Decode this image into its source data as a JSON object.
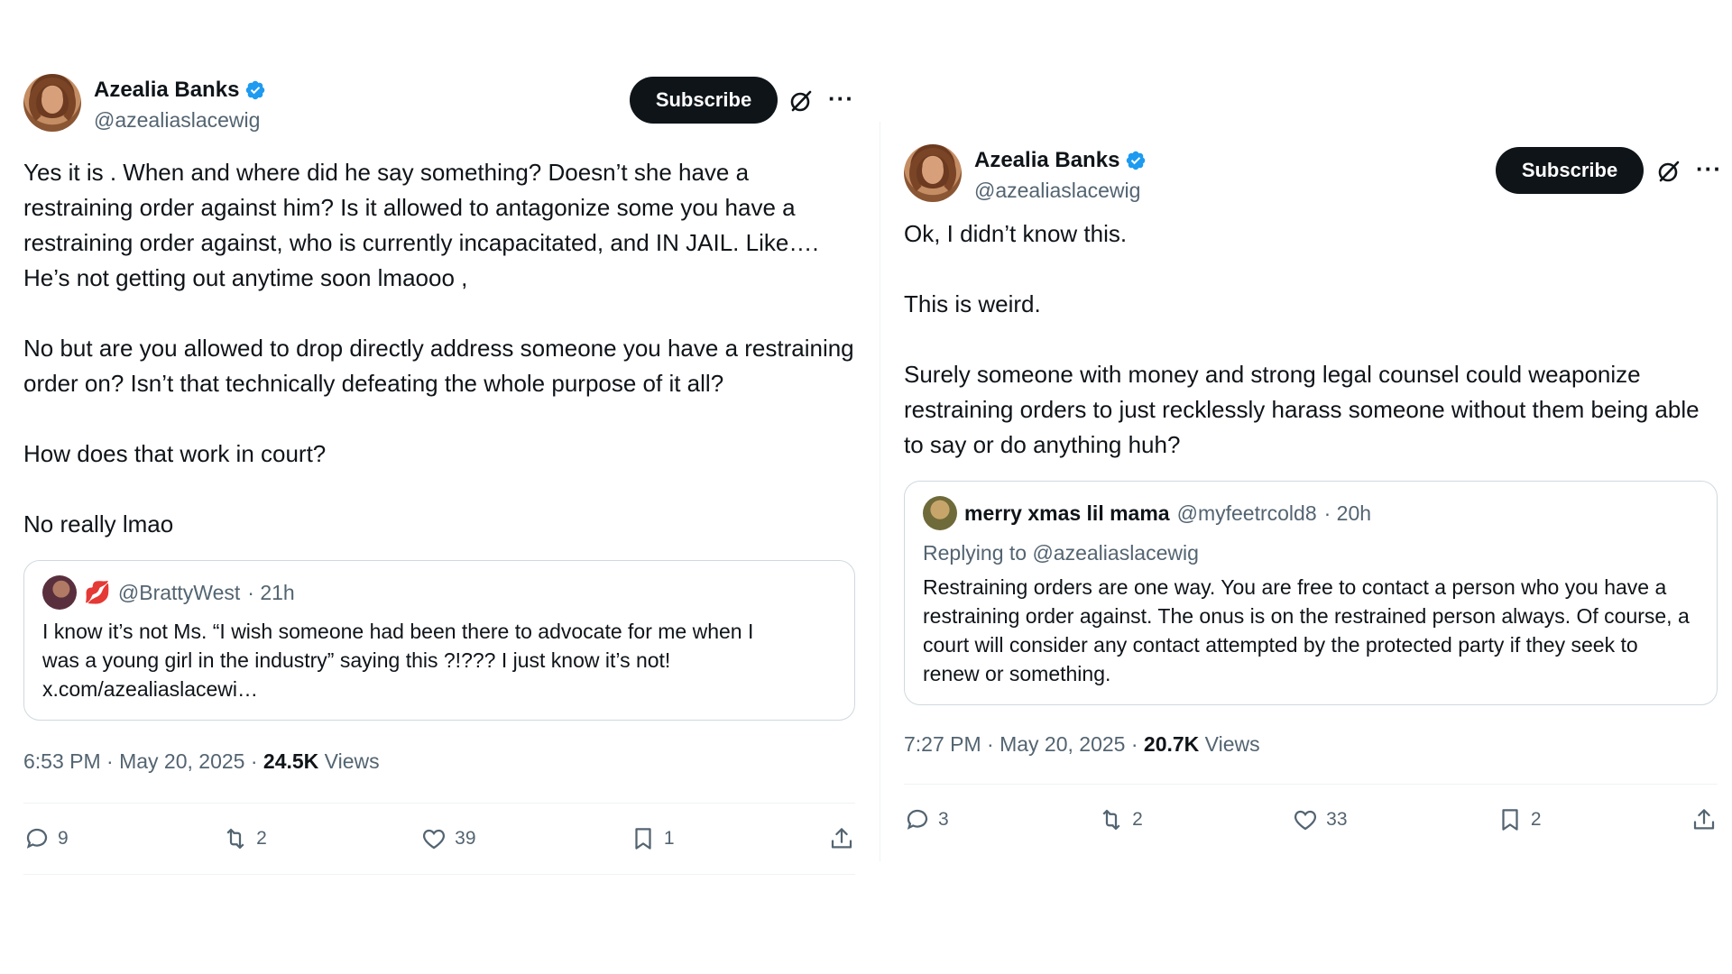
{
  "tweets": [
    {
      "display_name": "Azealia Banks",
      "handle": "@azealiaslacewig",
      "subscribe_label": "Subscribe",
      "more_label": "···",
      "paragraphs": [
        "Yes it is . When and where did he say something? Doesn’t she have a restraining order against him? Is it allowed to antagonize some you have a restraining order against, who is currently incapacitated, and IN JAIL. Like…. He’s not getting out anytime soon lmaooo ,",
        "No but are you allowed to drop directly address someone you have a restraining order on? Isn’t that technically defeating the whole purpose of it all?",
        "How does that work in court?",
        "No really lmao"
      ],
      "quote": {
        "emoji": "💋",
        "handle": "@BrattyWest",
        "time": "· 21h",
        "text_line1": "I know it’s not Ms. “I wish someone had been there to advocate for me when I",
        "text_line2": "was a young girl in the industry” saying this ?!??? I just know it’s not!",
        "text_line3": "x.com/azealiaslacewi…"
      },
      "time": "6:53 PM · May 20, 2025 ·",
      "views_count": "24.5K",
      "views_label": "Views",
      "actions": {
        "replies": "9",
        "reposts": "2",
        "likes": "39",
        "bookmarks": "1"
      }
    },
    {
      "display_name": "Azealia Banks",
      "handle": "@azealiaslacewig",
      "subscribe_label": "Subscribe",
      "more_label": "···",
      "paragraphs": [
        "Ok, I didn’t know this.",
        "This is weird.",
        "Surely someone with money and strong legal counsel could weaponize restraining orders to just recklessly harass someone without them being able to say or do anything huh?"
      ],
      "quote": {
        "name": "merry xmas lil mama",
        "handle": "@myfeetrcold8",
        "time": "· 20h",
        "replying": "Replying to @azealiaslacewig",
        "text": "Restraining orders are one way. You are free to contact a person who you have a restraining order against. The onus is on the restrained person always. Of course, a court will consider any contact attempted by the protected party if they seek to renew or something."
      },
      "time": "7:27 PM · May 20, 2025 ·",
      "views_count": "20.7K",
      "views_label": "Views",
      "actions": {
        "replies": "3",
        "reposts": "2",
        "likes": "33",
        "bookmarks": "2"
      }
    }
  ],
  "icons": {
    "verified": "verified-badge-icon",
    "grok": "grok-icon",
    "more": "more-icon",
    "reply": "reply-icon",
    "repost": "repost-icon",
    "like": "heart-icon",
    "bookmark": "bookmark-icon",
    "share": "share-icon"
  },
  "colors": {
    "verified": "#1d9bf0",
    "text": "#0f1419",
    "muted": "#536471",
    "button": "#0f1419"
  }
}
